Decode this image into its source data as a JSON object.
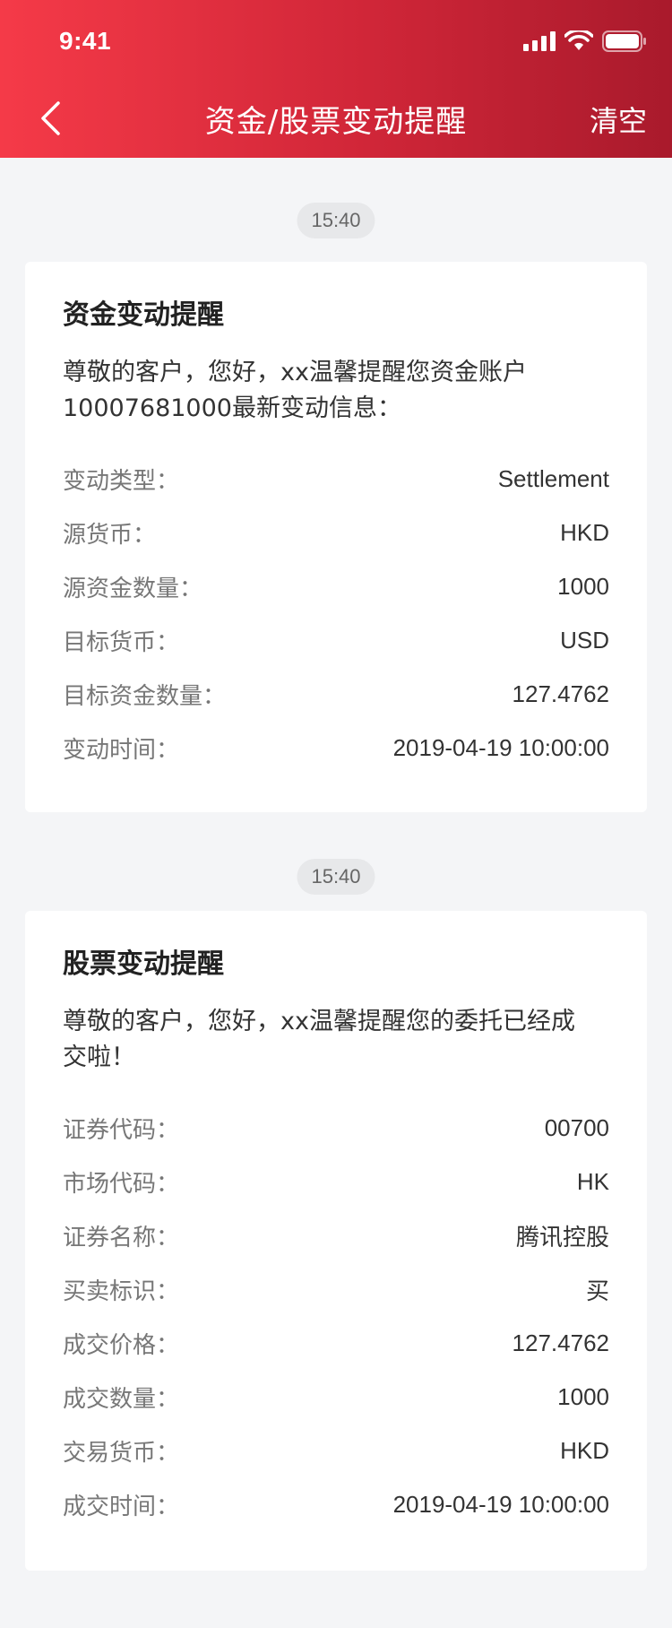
{
  "status_bar": {
    "time": "9:41"
  },
  "nav": {
    "title": "资金/股票变动提醒",
    "clear_label": "清空"
  },
  "messages": [
    {
      "time": "15:40",
      "title": "资金变动提醒",
      "description": "尊敬的客户，您好，xx温馨提醒您资金账户10007681000最新变动信息：",
      "rows": [
        {
          "label": "变动类型：",
          "value": "Settlement"
        },
        {
          "label": "源货币：",
          "value": "HKD"
        },
        {
          "label": "源资金数量：",
          "value": "1000"
        },
        {
          "label": "目标货币：",
          "value": "USD"
        },
        {
          "label": "目标资金数量：",
          "value": "127.4762"
        },
        {
          "label": "变动时间：",
          "value": "2019-04-19 10:00:00"
        }
      ]
    },
    {
      "time": "15:40",
      "title": "股票变动提醒",
      "description": "尊敬的客户，您好，xx温馨提醒您的委托已经成交啦！",
      "rows": [
        {
          "label": "证券代码：",
          "value": "00700"
        },
        {
          "label": "市场代码：",
          "value": "HK"
        },
        {
          "label": "证券名称：",
          "value": "腾讯控股"
        },
        {
          "label": "买卖标识：",
          "value": "买"
        },
        {
          "label": "成交价格：",
          "value": "127.4762"
        },
        {
          "label": "成交数量：",
          "value": "1000"
        },
        {
          "label": "交易货币：",
          "value": "HKD"
        },
        {
          "label": "成交时间：",
          "value": "2019-04-19 10:00:00"
        }
      ]
    }
  ],
  "icons": {
    "back": "chevron-left-icon",
    "signal": "cellular-signal-icon",
    "wifi": "wifi-icon",
    "battery": "battery-icon"
  },
  "colors": {
    "header_start": "#f53a48",
    "header_end": "#a91a2c",
    "background": "#f4f5f7"
  }
}
